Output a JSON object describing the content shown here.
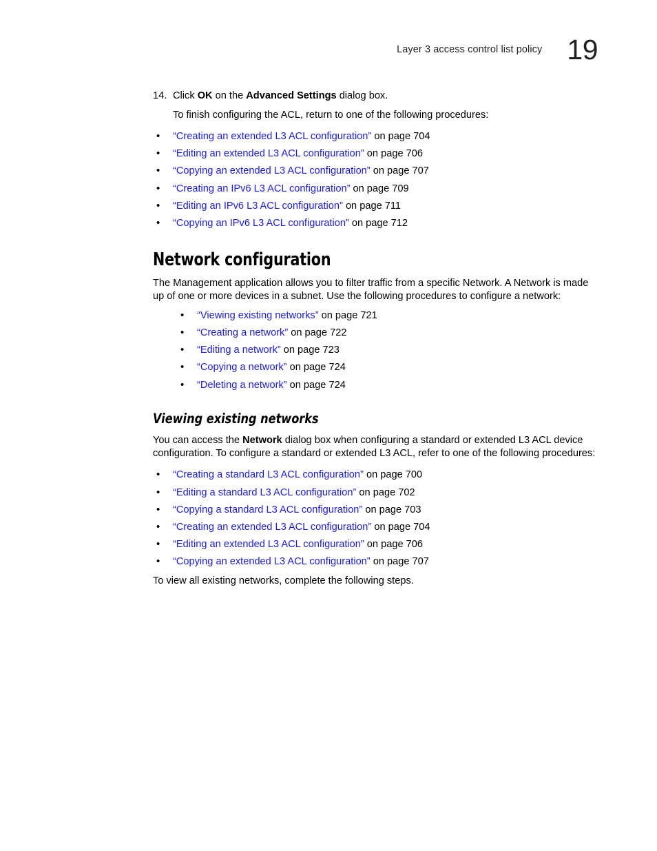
{
  "header": {
    "title": "Layer 3 access control list policy",
    "chapter_number": "19"
  },
  "colors": {
    "link": "#1818ff",
    "text": "#000000",
    "background": "#ffffff"
  },
  "step": {
    "number": "14.",
    "text_prefix": "Click ",
    "bold_1": "OK",
    "text_middle": " on the ",
    "bold_2": "Advanced Settings",
    "text_suffix": " dialog box.",
    "sub_text": "To finish configuring the ACL, return to one of the following procedures:"
  },
  "acl_return_list": [
    {
      "link": "“Creating an extended L3 ACL configuration”",
      "suffix": " on page 704"
    },
    {
      "link": "“Editing an extended L3 ACL configuration”",
      "suffix": " on page 706"
    },
    {
      "link": "“Copying an extended L3 ACL configuration”",
      "suffix": " on page 707"
    },
    {
      "link": "“Creating an IPv6 L3 ACL configuration”",
      "suffix": " on page 709"
    },
    {
      "link": "“Editing an IPv6 L3 ACL configuration”",
      "suffix": " on page 711"
    },
    {
      "link": "“Copying an IPv6 L3 ACL configuration”",
      "suffix": " on page 712"
    }
  ],
  "network_configuration": {
    "heading": "Network configuration",
    "paragraph": "The Management application allows you to filter traffic from a specific Network. A Network is made up of one or more devices in a subnet. Use the following procedures to configure a network:",
    "procedures": [
      {
        "link": "“Viewing existing networks”",
        "suffix": " on page 721"
      },
      {
        "link": "“Creating a network”",
        "suffix": " on page 722"
      },
      {
        "link": "“Editing a network”",
        "suffix": " on page 723"
      },
      {
        "link": "“Copying a network”",
        "suffix": " on page 724"
      },
      {
        "link": "“Deleting a network”",
        "suffix": " on page 724"
      }
    ]
  },
  "viewing_existing_networks": {
    "heading": "Viewing existing networks",
    "paragraph_prefix": "You can access the ",
    "paragraph_bold": "Network",
    "paragraph_suffix": " dialog box when configuring a standard or extended L3 ACL device configuration. To configure a standard or extended L3 ACL, refer to one of the following procedures:",
    "procedures": [
      {
        "link": "“Creating a standard L3 ACL configuration”",
        "suffix": " on page 700"
      },
      {
        "link": "“Editing a standard L3 ACL configuration”",
        "suffix": " on page 702"
      },
      {
        "link": "“Copying a standard L3 ACL configuration”",
        "suffix": " on page 703"
      },
      {
        "link": "“Creating an extended L3 ACL configuration”",
        "suffix": " on page 704"
      },
      {
        "link": "“Editing an extended L3 ACL configuration”",
        "suffix": " on page 706"
      },
      {
        "link": "“Copying an extended L3 ACL configuration”",
        "suffix": " on page 707"
      }
    ],
    "closing_line": "To view all existing networks, complete the following steps."
  }
}
